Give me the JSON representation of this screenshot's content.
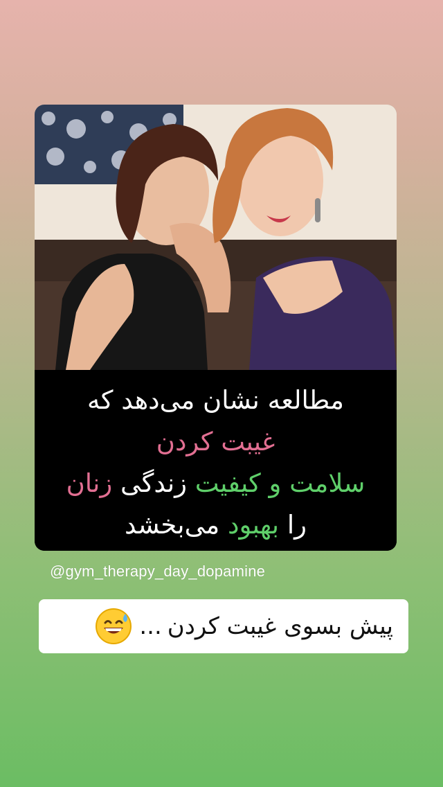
{
  "post": {
    "caption_lines": {
      "line1": "مطالعه نشان می‌دهد که",
      "line2": "غیبت کردن",
      "line3_green": "سلامت و کیفیت",
      "line3_white": " زندگی ",
      "line3_pink": "زنان",
      "line4_white_a": "را ",
      "line4_green": "بهبود",
      "line4_white_b": " می‌بخشد"
    },
    "username": "@gym_therapy_day_dopamine",
    "sticker_text": "پیش بسوی غیبت کردن",
    "sticker_dots": "...",
    "emoji_icon": "grinning-sweat-icon"
  },
  "colors": {
    "pink": "#e26f92",
    "green": "#5fcf6a",
    "gradient_top": "#e6b3ac",
    "gradient_bottom": "#6bbd63"
  }
}
